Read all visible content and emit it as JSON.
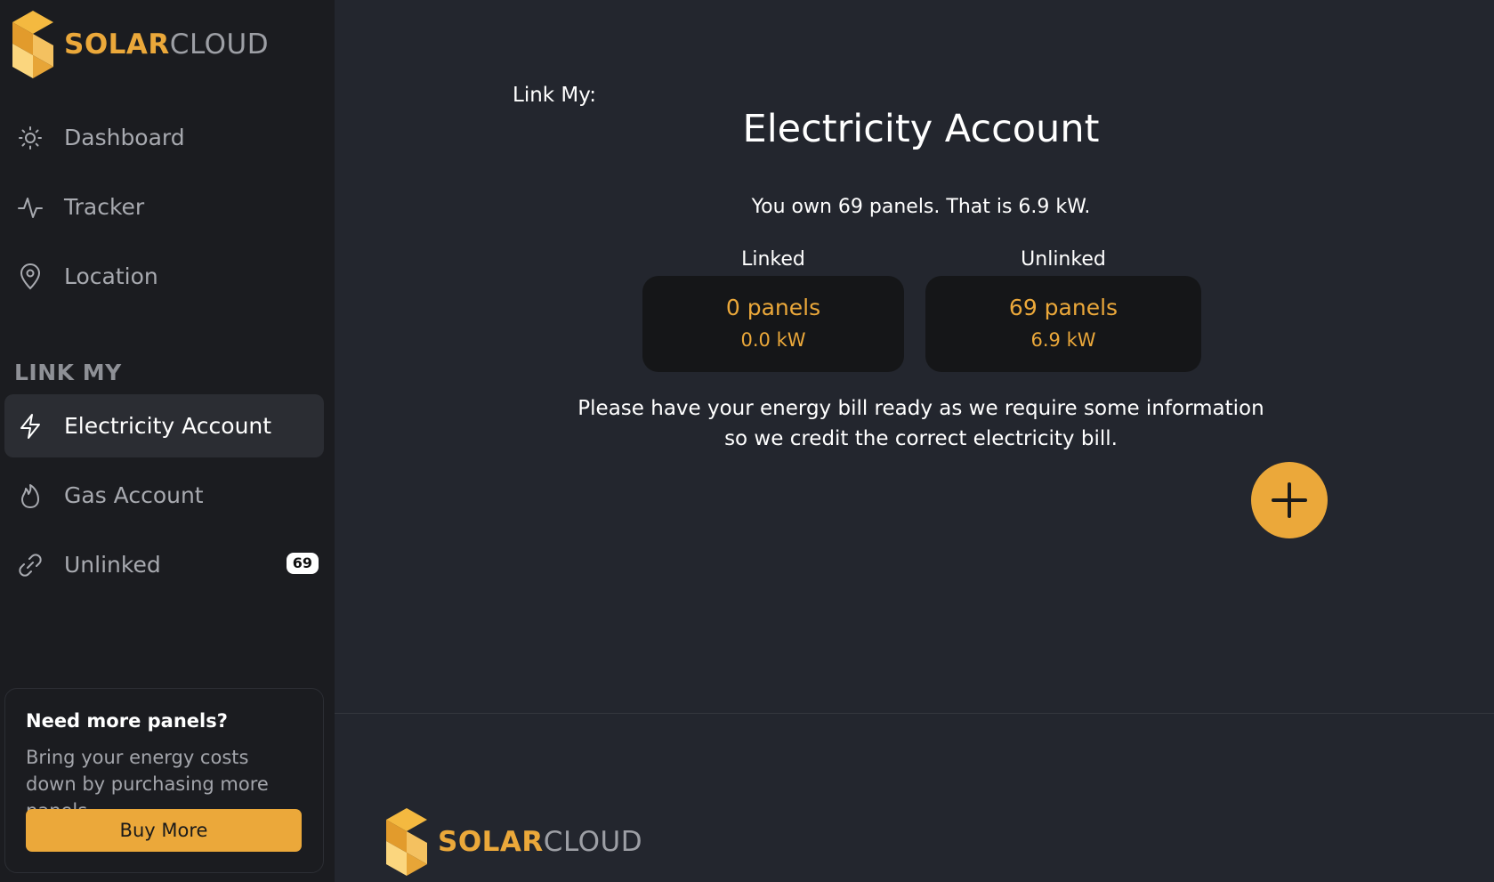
{
  "brand": {
    "solar": "SOLAR",
    "cloud": "CLOUD"
  },
  "sidebar": {
    "nav": [
      {
        "label": "Dashboard",
        "icon": "sun-icon"
      },
      {
        "label": "Tracker",
        "icon": "activity-icon"
      },
      {
        "label": "Location",
        "icon": "location-pin-icon"
      }
    ],
    "section_title": "LINK MY",
    "link_items": [
      {
        "label": "Electricity Account",
        "icon": "lightning-icon",
        "active": true
      },
      {
        "label": "Gas Account",
        "icon": "flame-icon"
      },
      {
        "label": "Unlinked",
        "icon": "link-icon",
        "badge": "69"
      }
    ],
    "promo": {
      "title": "Need more panels?",
      "text": "Bring your energy costs down by purchasing more panels.",
      "button": "Buy More"
    }
  },
  "main": {
    "link_my_label": "Link My:",
    "title": "Electricity Account",
    "summary": "You own 69 panels. That is 6.9 kW.",
    "linked": {
      "label": "Linked",
      "panels": "0 panels",
      "kw": "0.0 kW"
    },
    "unlinked": {
      "label": "Unlinked",
      "panels": "69 panels",
      "kw": "6.9 kW"
    },
    "info_line1": "Please have your energy bill ready as we require some information",
    "info_line2": "so we credit the correct electricity bill."
  },
  "colors": {
    "accent": "#eba83a",
    "sidebar_bg": "#1b1c20",
    "main_bg": "#23262e",
    "card_bg": "#151618"
  }
}
